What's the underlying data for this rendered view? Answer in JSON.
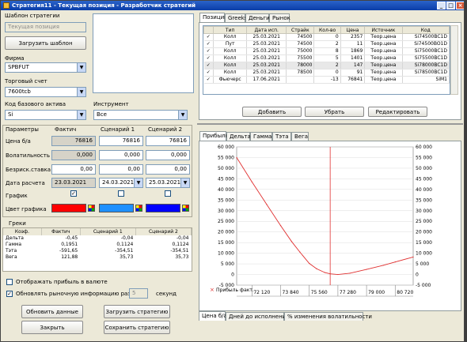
{
  "window": {
    "title": "Стратегия11 - Текущая позиция - Разработчик стратегий",
    "min": "_",
    "max": "□",
    "close": "×"
  },
  "left": {
    "template_label": "Шаблон стратегии",
    "template_value": "Текущая позиция",
    "load_template": "Загрузить шаблон",
    "firm_label": "Фирма",
    "firm_value": "SPBFUT",
    "account_label": "Торговый счет",
    "account_value": "7600tcb",
    "base_code_label": "Код базового актива",
    "base_code_value": "Si",
    "instrument_label": "Инструмент",
    "instrument_value": "Все"
  },
  "params": {
    "title": "Параметры",
    "col_fact": "Фактич",
    "col_s1": "Сценарий 1",
    "col_s2": "Сценарий 2",
    "rows": {
      "price": {
        "label": "Цена б/а",
        "fact": "76816",
        "s1": "76816",
        "s2": "76816"
      },
      "vol": {
        "label": "Волатильность",
        "fact": "0,000",
        "s1": "0,000",
        "s2": "0,000"
      },
      "rate": {
        "label": "Безриск.ставка",
        "fact": "0,00",
        "s1": "0,00",
        "s2": "0,00"
      },
      "date": {
        "label": "Дата расчета",
        "fact": "23.03.2021",
        "s1": "24.03.2021",
        "s2": "25.03.2021"
      },
      "chart": {
        "label": "График",
        "fact": "✓",
        "s1": "",
        "s2": ""
      },
      "color": {
        "label": "Цвет графика"
      }
    },
    "colors": {
      "fact": "#ff0000",
      "s1": "#1e90ff",
      "s2": "#0000ff"
    }
  },
  "greeks": {
    "title": "Греки",
    "headers": [
      "Коэф.",
      "Фактич",
      "Сценарий 1",
      "Сценарий 2"
    ],
    "rows": [
      [
        "Дельта",
        "-0,45",
        "-0,04",
        "-0,04"
      ],
      [
        "Гамма",
        "0,1951",
        "0,1124",
        "0,1124"
      ],
      [
        "Тэта",
        "-591,65",
        "-354,51",
        "-354,51"
      ],
      [
        "Вега",
        "121,88",
        "35,73",
        "35,73"
      ]
    ]
  },
  "bottom": {
    "show_currency": "Отображать прибыль в валюте",
    "update_prefix": "Обновлять рыночную информацию раз в",
    "update_value": "5",
    "update_suffix": "секунд",
    "update_btn": "Обновить данные",
    "load_strategy": "Загрузить стратегию",
    "close_btn": "Закрыть",
    "save_strategy": "Сохранить стратегию"
  },
  "position": {
    "tabs": [
      "Позиции",
      "Greeks",
      "Деньги",
      "Рынок"
    ],
    "headers": [
      "",
      "Тип",
      "Дата исп.",
      "Страйк",
      "Кол-во",
      "Цена",
      "Источник",
      "Код"
    ],
    "rows": [
      {
        "chk": "✓",
        "type": "Колл",
        "date": "25.03.2021",
        "strike": "74500",
        "qty": "0",
        "price": "2357",
        "src": "Теор.цена",
        "code": "Si74500BC1D"
      },
      {
        "chk": "✓",
        "type": "Пут",
        "date": "25.03.2021",
        "strike": "74500",
        "qty": "2",
        "price": "11",
        "src": "Теор.цена",
        "code": "Si74500BO1D"
      },
      {
        "chk": "✓",
        "type": "Колл",
        "date": "25.03.2021",
        "strike": "75000",
        "qty": "8",
        "price": "1869",
        "src": "Теор.цена",
        "code": "Si75000BC1D"
      },
      {
        "chk": "✓",
        "type": "Колл",
        "date": "25.03.2021",
        "strike": "75500",
        "qty": "5",
        "price": "1401",
        "src": "Теор.цена",
        "code": "Si75500BC1D"
      },
      {
        "chk": "✓",
        "type": "Колл",
        "date": "25.03.2021",
        "strike": "78000",
        "qty": "2",
        "price": "147",
        "src": "Теор.цена",
        "code": "Si78000BC1D"
      },
      {
        "chk": "✓",
        "type": "Колл",
        "date": "25.03.2021",
        "strike": "78500",
        "qty": "0",
        "price": "91",
        "src": "Теор.цена",
        "code": "Si78500BC1D"
      },
      {
        "chk": "✓",
        "type": "Фьючерс",
        "date": "17.06.2021",
        "strike": "",
        "qty": "-13",
        "price": "76841",
        "src": "Теор.цена",
        "code": "SiM1"
      }
    ],
    "add": "Добавить",
    "remove": "Убрать",
    "edit": "Редактировать"
  },
  "charttabs": [
    "Прибыль",
    "Дельта",
    "Гамма",
    "Тэта",
    "Вега"
  ],
  "bottomtabs": [
    "Цена б/а",
    "Дней до исполнения",
    "% изменения волатильности"
  ],
  "chart_data": {
    "type": "line",
    "legend": "Прибыль факт.",
    "ylim": [
      -5000,
      60000
    ],
    "yticks": [
      "60 000",
      "55 000",
      "50 000",
      "45 000",
      "40 000",
      "35 000",
      "30 000",
      "25 000",
      "20 000",
      "15 000",
      "10 000",
      "5 000",
      "0",
      "-5 000"
    ],
    "xticks": [
      "72 120",
      "73 840",
      "75 560",
      "77 280",
      "79 000",
      "80 720"
    ],
    "xlim": [
      71200,
      81800
    ],
    "current_price": 76816,
    "series": [
      {
        "name": "Прибыль факт.",
        "color": "#e03030",
        "x": [
          71200,
          72120,
          73000,
          73840,
          74500,
          75000,
          75560,
          76000,
          76500,
          76816,
          77280,
          78000,
          79000,
          80000,
          80720,
          81800
        ],
        "y": [
          55000,
          43500,
          33000,
          23000,
          15500,
          10500,
          5200,
          2700,
          900,
          300,
          0,
          600,
          2400,
          4300,
          5900,
          8200
        ]
      }
    ]
  }
}
